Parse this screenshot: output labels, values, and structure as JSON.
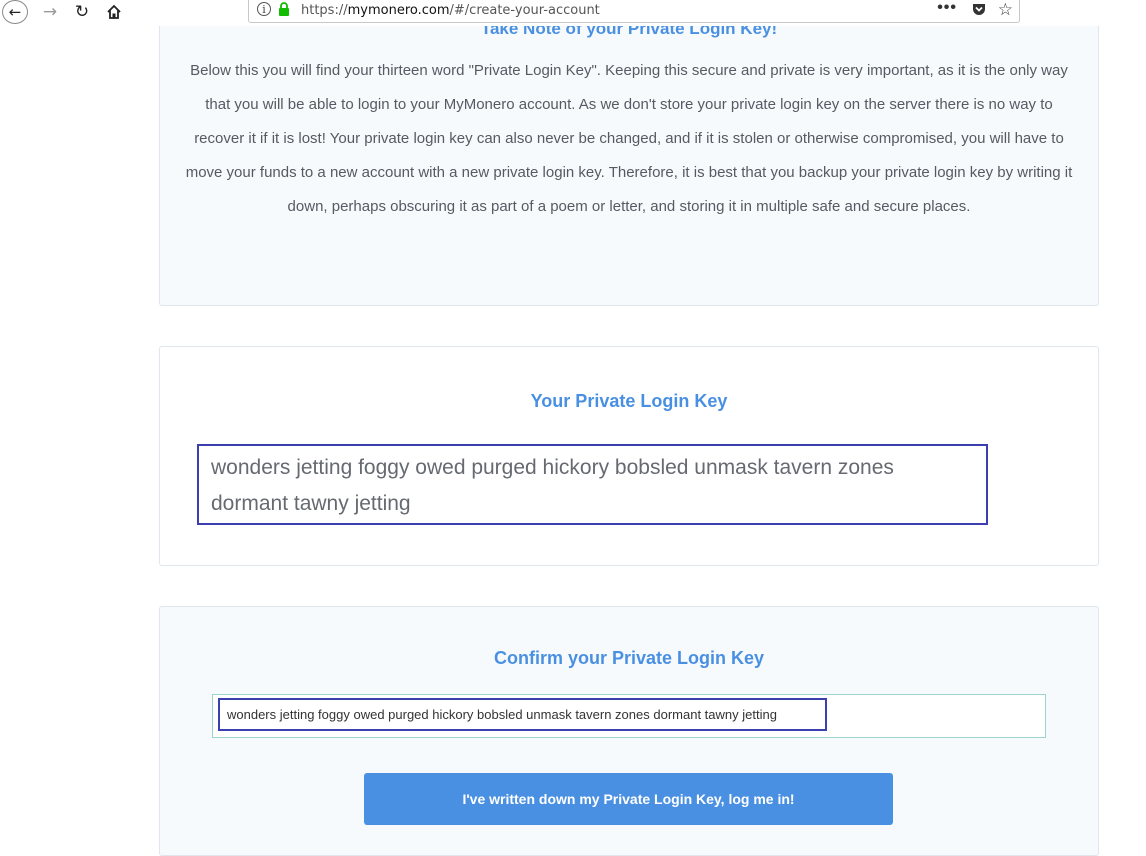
{
  "browser": {
    "url_prefix": "https://",
    "url_host": "mymonero.com",
    "url_path": "/#/create-your-account",
    "back_glyph": "←",
    "forward_glyph": "→",
    "reload_glyph": "↻",
    "home_glyph": "⌂",
    "info_glyph": "i",
    "more_glyph": "•••",
    "star_glyph": "☆",
    "icons": [
      "back-icon",
      "forward-icon",
      "reload-icon",
      "home-icon",
      "info-icon",
      "lock-icon",
      "more-icon",
      "pocket-icon",
      "star-icon"
    ]
  },
  "note": {
    "title": "Take Note of your Private Login Key!",
    "body": "Below this you will find your thirteen word \"Private Login Key\". Keeping this secure and private is very important, as it is the only way that you will be able to login to your MyMonero account. As we don't store your private login key on the server there is no way to recover it if it is lost! Your private login key can also never be changed, and if it is stolen or otherwise compromised, you will have to move your funds to a new account with a new private login key. Therefore, it is best that you backup your private login key by writing it down, perhaps obscuring it as part of a poem or letter, and storing it in multiple safe and secure places."
  },
  "key_section": {
    "title": "Your Private Login Key",
    "key": "wonders jetting foggy owed purged hickory bobsled unmask tavern zones dormant tawny jetting"
  },
  "confirm_section": {
    "title": "Confirm your Private Login Key",
    "input_value": "wonders jetting foggy owed purged hickory bobsled unmask tavern zones dormant tawny jetting",
    "submit_label": "I've written down my Private Login Key, log me in!"
  },
  "colors": {
    "accent": "#4a90e2",
    "highlight_border": "#3b3fb0",
    "card_bg": "#f7fafd",
    "lock_green": "#12bc00"
  }
}
